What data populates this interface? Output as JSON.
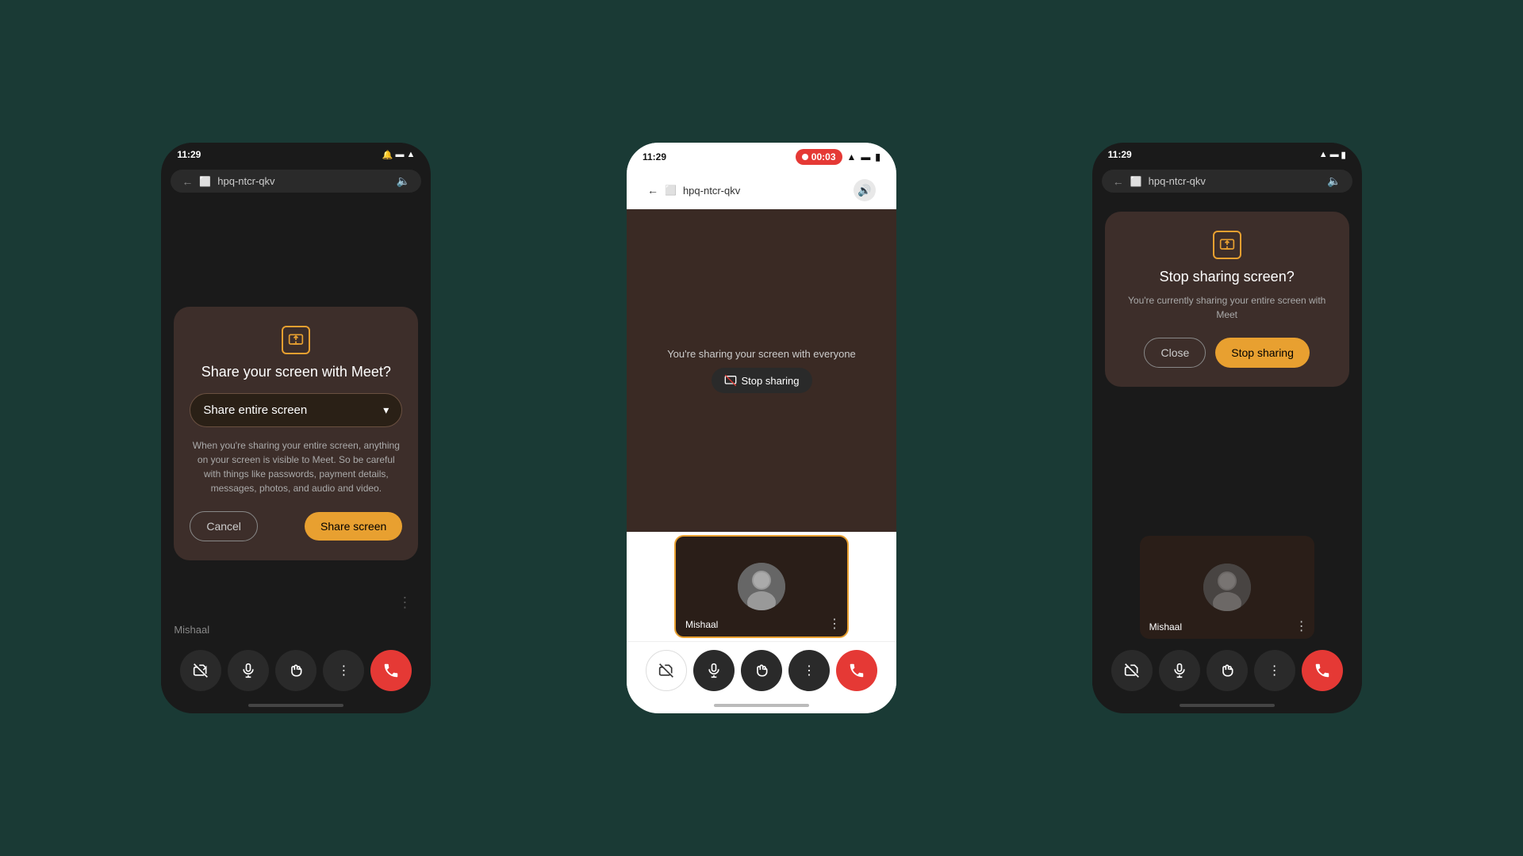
{
  "background_color": "#1a3a35",
  "screens": [
    {
      "id": "phone1",
      "status_bar": {
        "time": "11:29",
        "icons": [
          "notification",
          "battery",
          "wifi"
        ]
      },
      "address_bar": {
        "url": "hpq-ntcr-qkv",
        "back": "←",
        "tab_icon": "☰"
      },
      "dialog": {
        "title": "Share your screen with Meet?",
        "dropdown_value": "Share entire screen",
        "warning_text": "When you're sharing your entire screen, anything on your screen is visible to Meet. So be careful with things like passwords, payment details, messages, photos, and audio and video.",
        "cancel_label": "Cancel",
        "share_label": "Share screen"
      },
      "participant_name": "Mishaal",
      "controls": [
        "camera-off",
        "mic",
        "hand",
        "more",
        "end-call"
      ]
    },
    {
      "id": "phone2",
      "status_bar": {
        "time": "11:29",
        "recording": "00:03",
        "icons": [
          "wifi",
          "signal",
          "battery"
        ]
      },
      "address_bar": {
        "url": "hpq-ntcr-qkv",
        "back": "←",
        "tab_icon": "☰"
      },
      "sharing_text": "You're sharing your screen with everyone",
      "stop_sharing_label": "Stop sharing",
      "participant_name": "Mishaal",
      "controls": [
        "camera-off",
        "mic",
        "hand",
        "more",
        "end-call"
      ]
    },
    {
      "id": "phone3",
      "status_bar": {
        "time": "11:29",
        "icons": [
          "wifi",
          "signal",
          "battery"
        ]
      },
      "address_bar": {
        "url": "hpq-ntcr-qkv",
        "back": "←",
        "tab_icon": "☰"
      },
      "dialog": {
        "title": "Stop sharing screen?",
        "description": "You're currently sharing your entire screen with Meet",
        "close_label": "Close",
        "stop_label": "Stop sharing"
      },
      "participant_name": "Mishaal",
      "controls": [
        "camera-off",
        "mic",
        "hand",
        "more",
        "end-call"
      ]
    }
  ]
}
